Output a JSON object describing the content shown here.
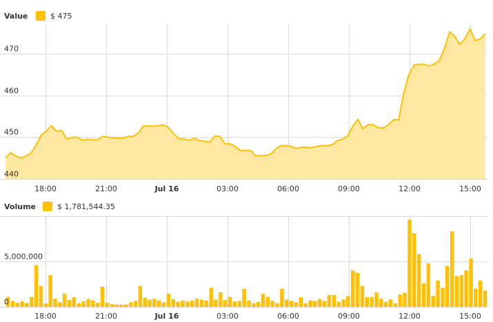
{
  "chart_data": [
    {
      "type": "area",
      "title": "Value",
      "legend_value": "$ 475",
      "color": "#FFC107",
      "fill_color": "#FDE7A1",
      "grid": true,
      "legend_position": "top-left",
      "x_ticks": [
        "18:00",
        "21:00",
        "Jul 16",
        "03:00",
        "06:00",
        "09:00",
        "12:00",
        "15:00"
      ],
      "y_ticks": [
        "440",
        "450",
        "460",
        "470"
      ],
      "ylim": [
        440,
        477
      ],
      "series": [
        {
          "values": [
            445,
            446.3,
            445.5,
            445,
            445.5,
            446.2,
            448.2,
            450.5,
            451.5,
            452.8,
            451.4,
            451.6,
            449.5,
            450,
            450,
            449.3,
            449.5,
            449.5,
            449.3,
            450.2,
            450,
            449.9,
            449.8,
            449.8,
            450.2,
            450.2,
            451,
            452.7,
            452.7,
            452.7,
            452.8,
            453,
            452.2,
            450.8,
            449.6,
            449.6,
            449.3,
            449.8,
            449.2,
            449,
            448.9,
            450.3,
            450.2,
            448.4,
            448.4,
            447.8,
            446.8,
            446.8,
            446.8,
            445.5,
            445.6,
            445.6,
            446,
            447.3,
            448,
            448,
            447.8,
            447.3,
            447.6,
            447.6,
            447.5,
            447.8,
            448,
            448,
            448.2,
            449.2,
            449.5,
            450.3,
            452.6,
            454.3,
            452,
            453,
            453,
            452.3,
            452.2,
            453,
            454.2,
            454.2,
            460.5,
            465,
            467.3,
            467.5,
            467.5,
            467.1,
            467.6,
            468.5,
            471.4,
            475.3,
            474.2,
            472.3,
            473.7,
            476,
            473.2,
            473.6,
            474.9
          ]
        }
      ]
    },
    {
      "type": "bar",
      "title": "Volume",
      "legend_value": "$ 1,781,544.35",
      "color": "#FFC107",
      "grid": true,
      "legend_position": "top-left",
      "x_ticks": [
        "18:00",
        "21:00",
        "Jul 16",
        "03:00",
        "06:00",
        "09:00",
        "12:00",
        "15:00"
      ],
      "y_ticks": [
        "0",
        "5,000,000"
      ],
      "ylim": [
        0,
        10000000
      ],
      "series": [
        {
          "values": [
            1100000,
            650000,
            450000,
            620000,
            420000,
            1100000,
            4600000,
            2300000,
            350000,
            3500000,
            900000,
            520000,
            1450000,
            750000,
            1050000,
            400000,
            600000,
            850000,
            720000,
            450000,
            2200000,
            450000,
            300000,
            250000,
            250000,
            250000,
            500000,
            650000,
            2300000,
            1000000,
            780000,
            900000,
            720000,
            500000,
            1450000,
            850000,
            550000,
            700000,
            600000,
            700000,
            900000,
            800000,
            700000,
            2100000,
            800000,
            1600000,
            750000,
            1100000,
            580000,
            650000,
            2000000,
            700000,
            400000,
            550000,
            1450000,
            1100000,
            650000,
            400000,
            2000000,
            800000,
            650000,
            500000,
            1050000,
            400000,
            700000,
            650000,
            850000,
            650000,
            1300000,
            1300000,
            550000,
            800000,
            1200000,
            4000000,
            3750000,
            2300000,
            1050000,
            1100000,
            1600000,
            900000,
            550000,
            800000,
            400000,
            1350000,
            1550000,
            9600000,
            8100000,
            5800000,
            2600000,
            4800000,
            1200000,
            2900000,
            2100000,
            4500000,
            8300000,
            3400000,
            3500000,
            4000000,
            5300000,
            2000000,
            2900000,
            1800000
          ]
        }
      ]
    }
  ]
}
